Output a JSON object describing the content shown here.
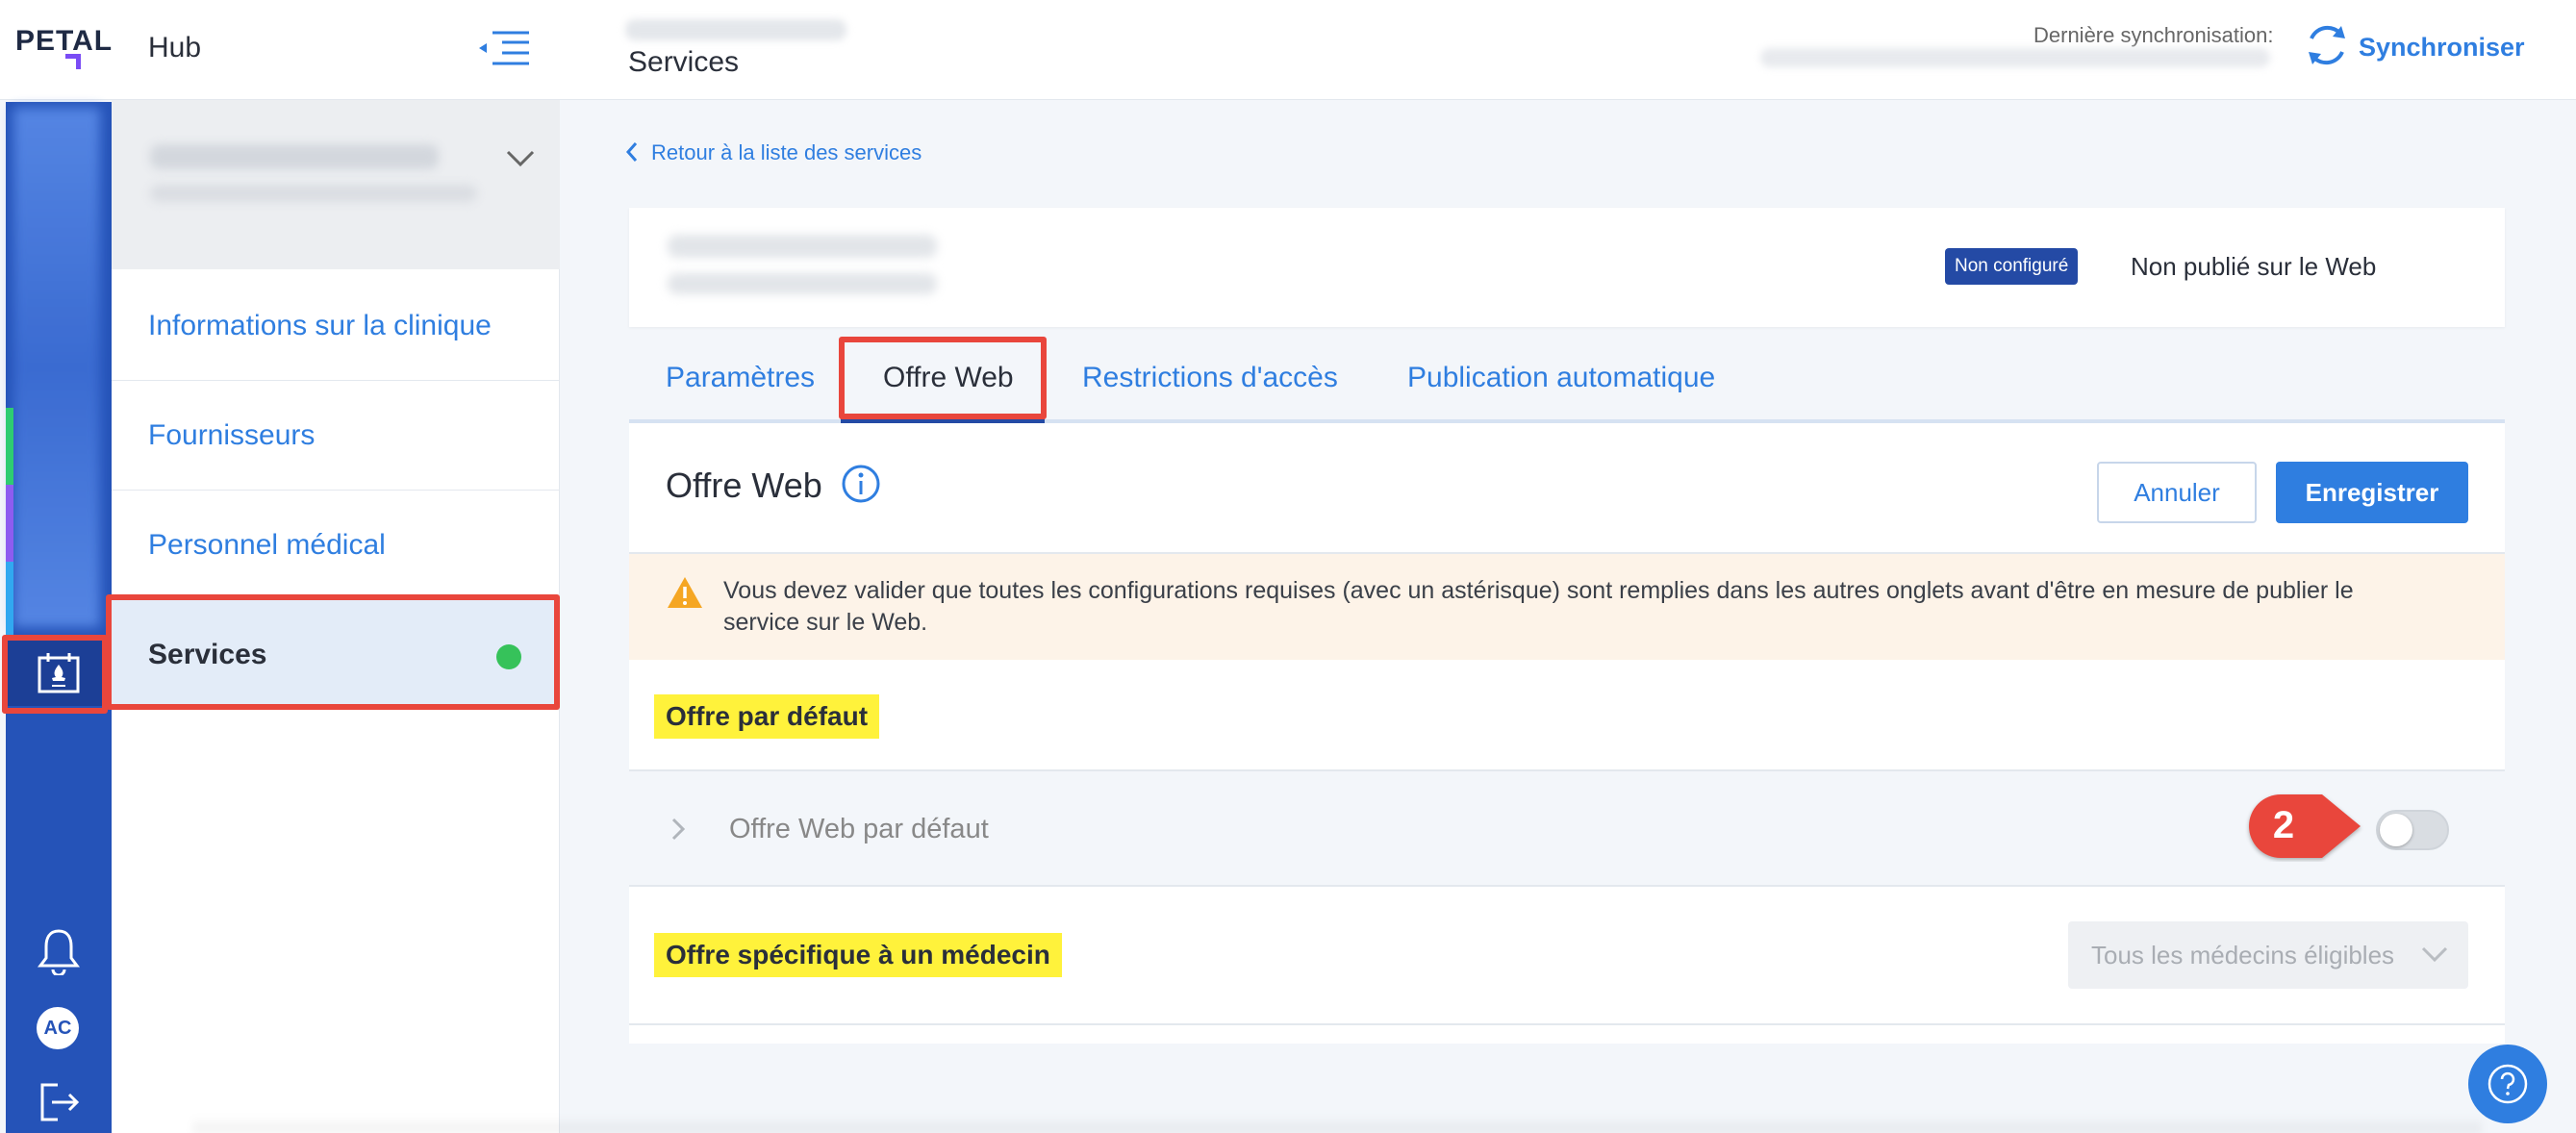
{
  "app": {
    "logo": "PETAL",
    "hub_title": "Hub",
    "page_title": "Services",
    "last_sync_label": "Dernière synchronisation:",
    "sync_label": "Synchroniser",
    "avatar_initials": "AC"
  },
  "nav": {
    "items": [
      {
        "label": "Informations sur la clinique"
      },
      {
        "label": "Fournisseurs"
      },
      {
        "label": "Personnel médical"
      },
      {
        "label": "Services",
        "active": true
      }
    ]
  },
  "service": {
    "back_link": "Retour à la liste des services",
    "badge": "Non configuré",
    "publish_status": "Non publié sur le Web"
  },
  "tabs": [
    {
      "label": "Paramètres"
    },
    {
      "label": "Offre Web",
      "active": true
    },
    {
      "label": "Restrictions d'accès"
    },
    {
      "label": "Publication automatique"
    }
  ],
  "panel": {
    "title": "Offre Web",
    "cancel": "Annuler",
    "save": "Enregistrer",
    "warning": "Vous devez valider que toutes les configurations requises (avec un astérisque) sont remplies dans les autres onglets avant d'être en mesure de publier le service sur le Web.",
    "section_default": "Offre par défaut",
    "default_row_label": "Offre Web par défaut",
    "default_toggle_on": false,
    "section_doctor": "Offre spécifique à un médecin",
    "doctor_select_value": "Tous les médecins éligibles"
  },
  "annotation": {
    "step_number": "2"
  },
  "colors": {
    "accent": "#2f7ee0",
    "rail": "#2553b8",
    "highlight_box": "#e9463c",
    "highlight_text": "#fff23b",
    "status_dot": "#36c25a"
  }
}
